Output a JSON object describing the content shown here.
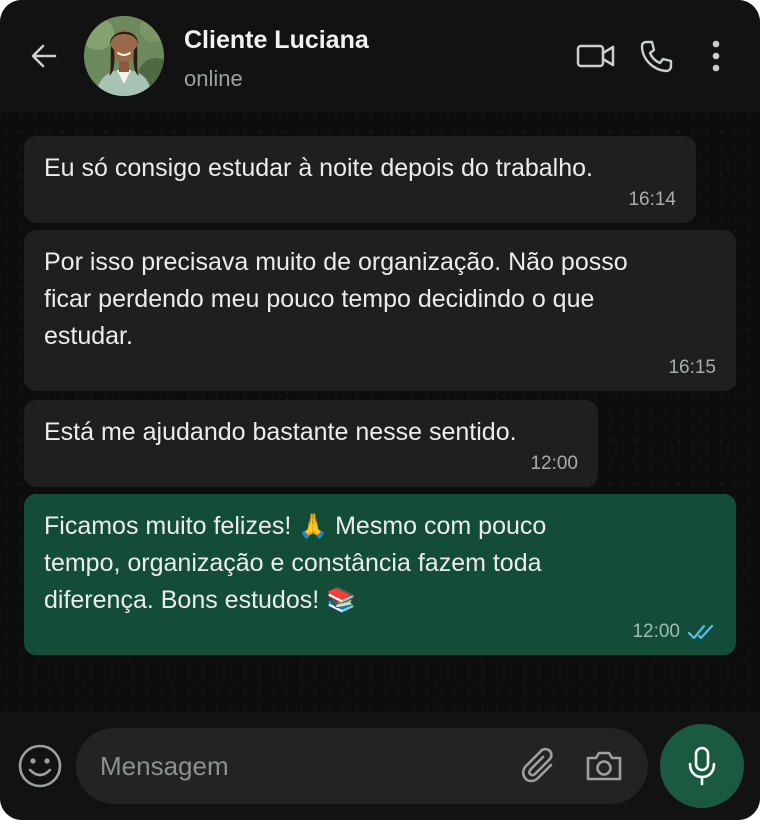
{
  "header": {
    "contact_name": "Cliente Luciana",
    "status": "online",
    "icons": {
      "back": "arrow-left-icon",
      "video": "video-call-icon",
      "call": "phone-icon",
      "menu": "more-vertical-icon"
    }
  },
  "messages": [
    {
      "direction": "incoming",
      "text": "Eu só consigo estudar à noite depois do trabalho.",
      "time": "16:14"
    },
    {
      "direction": "incoming",
      "text": "Por isso precisava muito de organização. Não posso\nficar perdendo meu pouco tempo decidindo o que\nestudar.",
      "time": "16:15"
    },
    {
      "direction": "incoming",
      "text": "Está me ajudando bastante nesse sentido.",
      "time": "12:00"
    },
    {
      "direction": "outgoing",
      "text_line1_before": "Ficamos muito felizes! ",
      "emoji1": "🙏",
      "text_line1_after": " Mesmo com pouco",
      "text_line2": "tempo, organização e constância fazem toda",
      "text_line3": "diferença. Bons estudos! ",
      "emoji2": "📚",
      "time": "12:00",
      "status": "read"
    }
  ],
  "composer": {
    "placeholder": "Mensagem",
    "icons": {
      "emoji": "smiley-icon",
      "attach": "paperclip-icon",
      "camera": "camera-icon",
      "mic": "microphone-icon"
    }
  },
  "colors": {
    "incoming_bubble": "#1f1f1f",
    "outgoing_bubble": "#134d37",
    "read_ticks": "#53bdeb",
    "mic_button": "#1a5a40"
  }
}
